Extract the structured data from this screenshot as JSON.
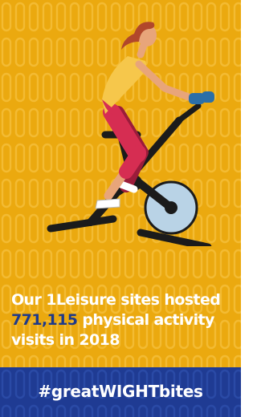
{
  "caption": {
    "line1": "Our 1Leisure sites hosted",
    "number": "771,115",
    "line2_rest": " physical activity",
    "line3": "visits in 2018"
  },
  "footer": {
    "hashtag": "#greatWIGHTbites"
  },
  "illustration": {
    "icon": "woman-on-exercise-bike-icon"
  },
  "colors": {
    "panel_background": "#eba90f",
    "footer_background": "#1f3b93",
    "number_highlight": "#1e3a8a",
    "text": "#ffffff"
  }
}
